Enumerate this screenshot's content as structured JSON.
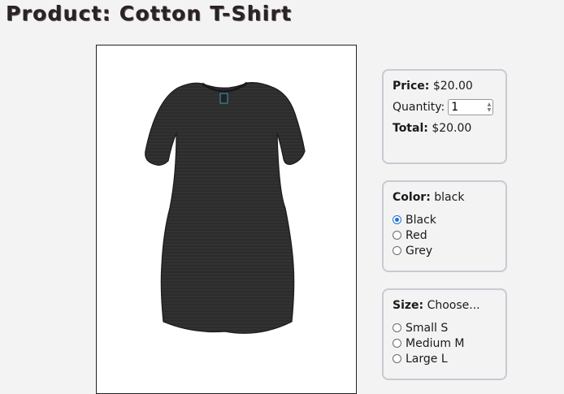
{
  "page": {
    "title": "Product: Cotton T-Shirt"
  },
  "image": {
    "alt": "Black cotton t-shirt"
  },
  "pricing": {
    "price_label": "Price:",
    "price_value": "$20.00",
    "quantity_label": "Quantity:",
    "quantity_value": "1",
    "total_label": "Total:",
    "total_value": "$20.00"
  },
  "color": {
    "label": "Color:",
    "selected": "black",
    "options": [
      "Black",
      "Red",
      "Grey"
    ],
    "checked_index": 0
  },
  "size": {
    "label": "Size:",
    "selected": "Choose...",
    "options": [
      "Small S",
      "Medium M",
      "Large L"
    ]
  },
  "theme": {
    "accent": "#1f6fd8",
    "panel_border": "#c9c9d3",
    "shirt": "#2c2c2c"
  }
}
